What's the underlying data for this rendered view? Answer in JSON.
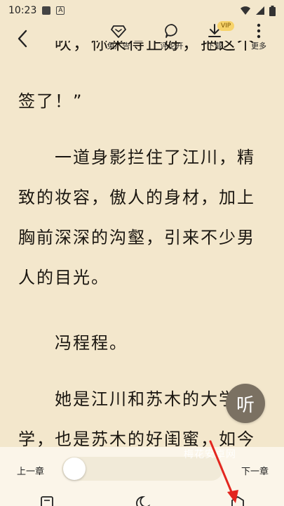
{
  "status": {
    "time": "10:23"
  },
  "toolbar": {
    "ad_free_label": "免广告",
    "comments_label": "评论开",
    "download_label": "下载",
    "vip_badge": "VIP",
    "more_label": "更多"
  },
  "reader": {
    "paragraphs": [
      "吹，你来得正好，把这个",
      "签了！”",
      "一道身影拦住了江川，精致的妆容，傲人的身材，加上胸前深深的沟壑，引来不少男人的目光。",
      "冯程程。",
      "她是江川和苏木的大学同学，也是苏木的好闺蜜，如今"
    ]
  },
  "listen_button": {
    "label": "听"
  },
  "chapter_bar": {
    "prev_label": "上一章",
    "next_label": "下一章",
    "progress_fraction": 0.0
  },
  "watermark": "梅花安卓网",
  "colors": {
    "page_bg": "#f3e7cc",
    "bar_bg": "#fbf5e9",
    "vip_badge": "#f7d36a",
    "listen_bg": "#7b7162",
    "annotation_arrow": "#e3261f"
  },
  "icons": {
    "back": "chevron-left-icon",
    "ad_free": "diamond-icon",
    "comments": "comment-bubble-icon",
    "download": "download-icon",
    "more": "more-vertical-icon"
  }
}
